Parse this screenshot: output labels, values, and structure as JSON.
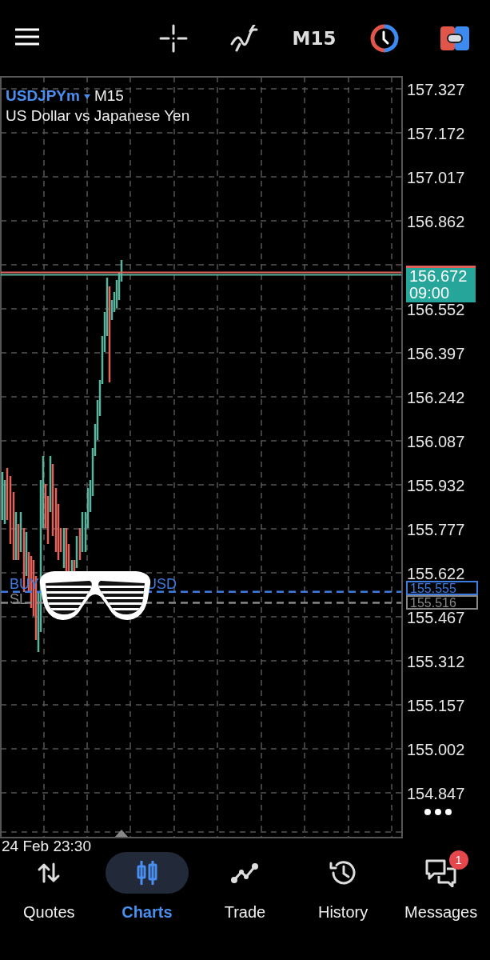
{
  "toolbar": {
    "timeframe": "M15"
  },
  "chart": {
    "symbol": "USDJPYm",
    "timeframe": "M15",
    "description": "US Dollar vs Japanese Yen",
    "price_ticks": [
      "157.327",
      "157.172",
      "157.017",
      "156.862",
      "156.552",
      "156.397",
      "156.242",
      "156.087",
      "155.932",
      "155.777",
      "155.622",
      "155.467",
      "155.312",
      "155.157",
      "155.002",
      "154.847"
    ],
    "current_price": "156.672",
    "bar_timer": "09:00",
    "order_line": {
      "label_left": "BUY",
      "label_right": "USD",
      "price": "155.555"
    },
    "stop_loss": {
      "label": "SL",
      "price": "155.516"
    },
    "time_label": "24 Feb 23:30"
  },
  "nav": [
    {
      "kind": "quotes",
      "label": "Quotes",
      "selected": false
    },
    {
      "kind": "charts",
      "label": "Charts",
      "selected": true
    },
    {
      "kind": "trade",
      "label": "Trade",
      "selected": false
    },
    {
      "kind": "history",
      "label": "History",
      "selected": false
    },
    {
      "kind": "messages",
      "label": "Messages",
      "selected": false,
      "badge": "1"
    }
  ]
}
